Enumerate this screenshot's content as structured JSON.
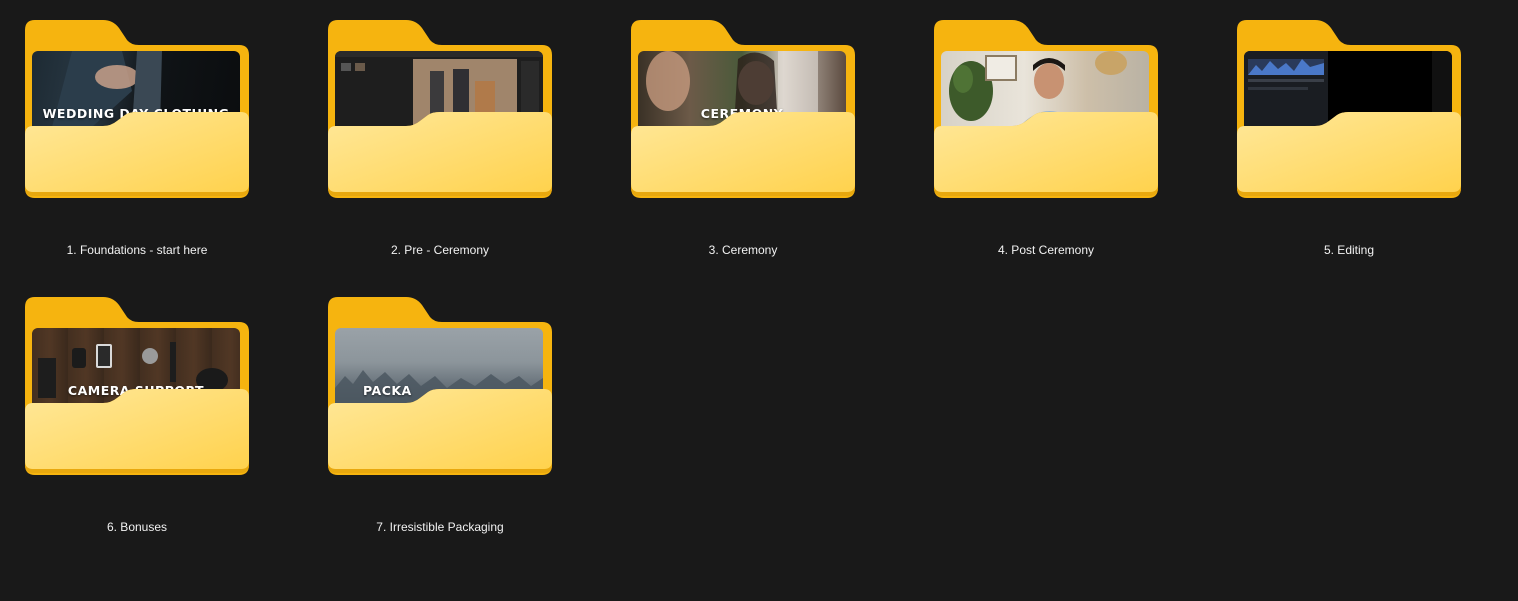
{
  "window": {
    "view": "Large icons"
  },
  "colors": {
    "background": "#191919",
    "folder_back": "#F6B40F",
    "folder_front_top": "#FFE89A",
    "folder_front_bottom": "#FFD24D",
    "label_text": "#F2F2F2"
  },
  "folders": [
    {
      "name": "1. Foundations - start here",
      "thumbnail_text": "WEDDING DAY CLOTHING",
      "icon": "folder-icon"
    },
    {
      "name": "2. Pre - Ceremony",
      "thumbnail_text": "",
      "icon": "folder-icon"
    },
    {
      "name": "3. Ceremony",
      "thumbnail_text": "CEREMONY",
      "icon": "folder-icon"
    },
    {
      "name": "4. Post Ceremony",
      "thumbnail_text": "",
      "icon": "folder-icon"
    },
    {
      "name": "5. Editing",
      "thumbnail_text": "",
      "icon": "folder-icon"
    },
    {
      "name": "6. Bonuses",
      "thumbnail_text": "CAMERA SUPPORT",
      "icon": "folder-icon"
    },
    {
      "name": "7. Irresistible Packaging",
      "thumbnail_text": "PACKA",
      "icon": "folder-icon"
    }
  ]
}
